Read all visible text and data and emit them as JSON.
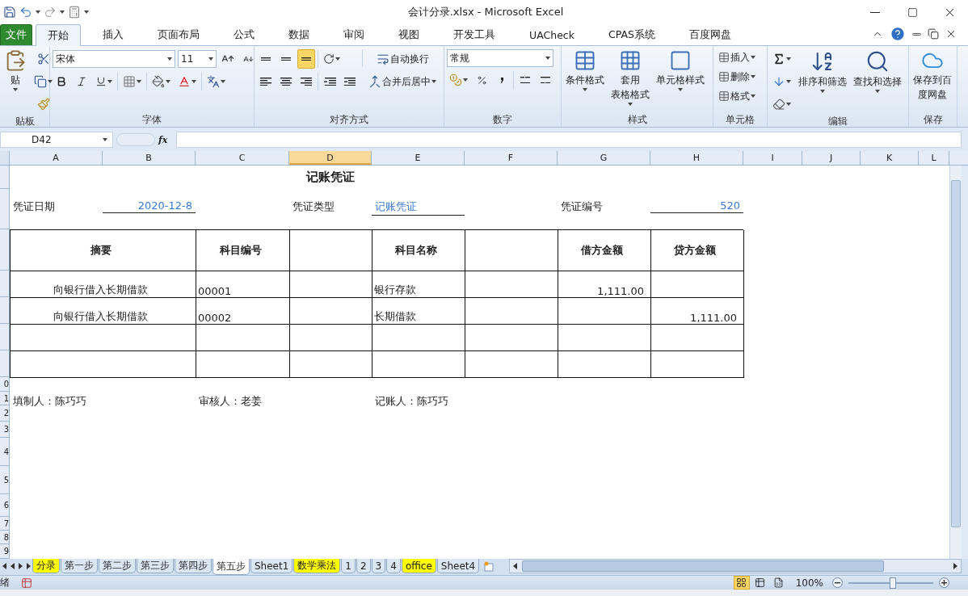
{
  "window": {
    "title": "会计分录.xlsx  -  Microsoft Excel"
  },
  "ribbon_tabs": [
    {
      "label": "文件",
      "kind": "file",
      "selected": false
    },
    {
      "label": "开始",
      "kind": "tab",
      "selected": true
    },
    {
      "label": "插入",
      "kind": "tab",
      "selected": false
    },
    {
      "label": "页面布局",
      "kind": "tab",
      "selected": false
    },
    {
      "label": "公式",
      "kind": "tab",
      "selected": false
    },
    {
      "label": "数据",
      "kind": "tab",
      "selected": false
    },
    {
      "label": "审阅",
      "kind": "tab",
      "selected": false
    },
    {
      "label": "视图",
      "kind": "tab",
      "selected": false
    },
    {
      "label": "开发工具",
      "kind": "tab",
      "selected": false
    },
    {
      "label": "UACheck",
      "kind": "tab",
      "selected": false
    },
    {
      "label": "CPAS系统",
      "kind": "tab",
      "selected": false
    },
    {
      "label": "百度网盘",
      "kind": "tab",
      "selected": false
    }
  ],
  "ribbon": {
    "clipboard": {
      "label": "贴板",
      "paste": "贴"
    },
    "font": {
      "label": "字体",
      "font_name": "宋体",
      "font_size": "11"
    },
    "alignment": {
      "label": "对齐方式",
      "vertical_align": [
        {
          "selected": false
        },
        {
          "selected": false
        },
        {
          "selected": true
        }
      ],
      "wrap_text": "自动换行",
      "merge_center": "合并后居中"
    },
    "number": {
      "label": "数字",
      "format": "常规"
    },
    "styles": {
      "label": "样式",
      "buttons": [
        {
          "lines": [
            "条件格式"
          ]
        },
        {
          "lines": [
            "套用",
            "表格格式"
          ]
        },
        {
          "lines": [
            "单元格样式"
          ]
        }
      ]
    },
    "cells": {
      "label": "单元格",
      "buttons": [
        "插入",
        "删除",
        "格式"
      ]
    },
    "editing": {
      "label": "编辑",
      "buttons": [
        {
          "lines": [
            "排序和筛选"
          ]
        },
        {
          "lines": [
            "查找和选择"
          ]
        }
      ]
    },
    "save": {
      "label": "保存",
      "button": {
        "lines": [
          "保存到百",
          "度网盘"
        ]
      }
    }
  },
  "formula_bar": {
    "name_box": "D42",
    "function_label": "fx"
  },
  "columns": [
    {
      "label": "A",
      "selected": false
    },
    {
      "label": "B",
      "selected": false
    },
    {
      "label": "C",
      "selected": false
    },
    {
      "label": "D",
      "selected": true
    },
    {
      "label": "E",
      "selected": false
    },
    {
      "label": "F",
      "selected": false
    },
    {
      "label": "G",
      "selected": false
    },
    {
      "label": "H",
      "selected": false
    },
    {
      "label": "I",
      "selected": false
    },
    {
      "label": "J",
      "selected": false
    },
    {
      "label": "K",
      "selected": false
    },
    {
      "label": "L",
      "selected": false
    }
  ],
  "row_headers": [
    "0",
    "1",
    "2",
    "3",
    "4",
    "5",
    "6",
    "7",
    "8",
    "9"
  ],
  "voucher": {
    "title": "记账凭证",
    "date_label": "凭证日期",
    "date": "2020-12-8",
    "type_label": "凭证类型",
    "type": "记账凭证",
    "number_label": "凭证编号",
    "number": "520",
    "columns": [
      {
        "kind": "heading",
        "label": "摘要"
      },
      {
        "kind": "heading",
        "label": "科目编号"
      },
      {
        "kind": "blank"
      },
      {
        "kind": "heading",
        "label": "科目名称"
      },
      {
        "kind": "blank"
      },
      {
        "kind": "heading",
        "label": "借方金额"
      },
      {
        "kind": "heading",
        "label": "贷方金额"
      }
    ],
    "rows": [
      {
        "kind": "entry",
        "summary": "向银行借入长期借款",
        "account_code": "00001",
        "account_name": "银行存款",
        "debit": "1,111.00"
      },
      {
        "kind": "entry",
        "summary": "向银行借入长期借款",
        "account_code": "00002",
        "account_name": "长期借款",
        "credit": "1,111.00"
      },
      {
        "kind": "blank"
      },
      {
        "kind": "blank"
      }
    ],
    "signatures": [
      "填制人：陈巧巧",
      "审核人：老姜",
      "记账人：陈巧巧"
    ]
  },
  "sheet_tabs": [
    {
      "label": "分录",
      "color": "#ffff00",
      "selected": false
    },
    {
      "label": "第一步",
      "selected": false
    },
    {
      "label": "第二步",
      "selected": false
    },
    {
      "label": "第三步",
      "selected": false
    },
    {
      "label": "第四步",
      "selected": false
    },
    {
      "label": "第五步",
      "selected": true
    },
    {
      "label": "Sheet1",
      "selected": false
    },
    {
      "label": "数学乘法",
      "color": "#ffff00",
      "selected": false
    },
    {
      "label": "1",
      "selected": false
    },
    {
      "label": "2",
      "selected": false
    },
    {
      "label": "3",
      "selected": false
    },
    {
      "label": "4",
      "selected": false
    },
    {
      "label": "office",
      "color": "#ffff00",
      "selected": false
    },
    {
      "label": "Sheet4",
      "selected": false
    }
  ],
  "status_bar": {
    "mode": "绪",
    "views": [
      {
        "kind": "normal",
        "selected": true
      },
      {
        "kind": "page_layout",
        "selected": false
      },
      {
        "kind": "page_break",
        "selected": false
      }
    ],
    "zoom": "100%",
    "zoom_slider": {
      "level": 0.52
    }
  }
}
